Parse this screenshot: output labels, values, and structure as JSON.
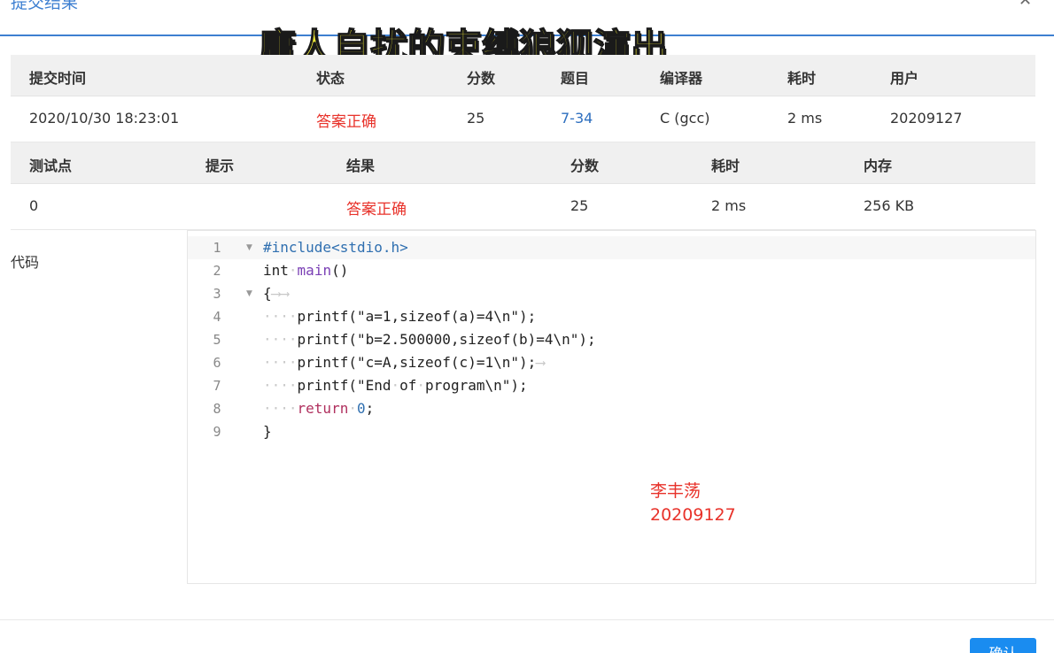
{
  "dialog": {
    "title": "提交结果",
    "close_icon": "close-icon",
    "confirm_label": "确认"
  },
  "overlay_caption": "庸人自扰的束缚狼狈演出",
  "submission": {
    "headers": [
      "提交时间",
      "状态",
      "分数",
      "题目",
      "编译器",
      "耗时",
      "用户"
    ],
    "row": {
      "time": "2020/10/30 18:23:01",
      "status": "答案正确",
      "score": "25",
      "problem": "7-34",
      "compiler": "C (gcc)",
      "elapsed": "2 ms",
      "user": "20209127"
    }
  },
  "testcases": {
    "headers": [
      "测试点",
      "提示",
      "结果",
      "分数",
      "耗时",
      "内存"
    ],
    "rows": [
      {
        "id": "0",
        "hint": "",
        "result": "答案正确",
        "score": "25",
        "elapsed": "2 ms",
        "memory": "256 KB"
      }
    ]
  },
  "code": {
    "label": "代码",
    "line_numbers": [
      "1",
      "2",
      "3",
      "4",
      "5",
      "6",
      "7",
      "8",
      "9"
    ],
    "lines": [
      "#include<stdio.h>",
      "int main()",
      "{",
      "    printf(\"a=1,sizeof(a)=4\\n\");",
      "    printf(\"b=2.500000,sizeof(b)=4\\n\");",
      "    printf(\"c=A,sizeof(c)=1\\n\");",
      "    printf(\"End of program\\n\");",
      "    return 0;",
      "}"
    ]
  },
  "watermark": {
    "name": "李丰荡",
    "id": "20209127"
  },
  "colors": {
    "accent": "#3d7fd1",
    "success": "#e8322a",
    "button": "#1a8cf0",
    "caption": "#f5ef38"
  }
}
